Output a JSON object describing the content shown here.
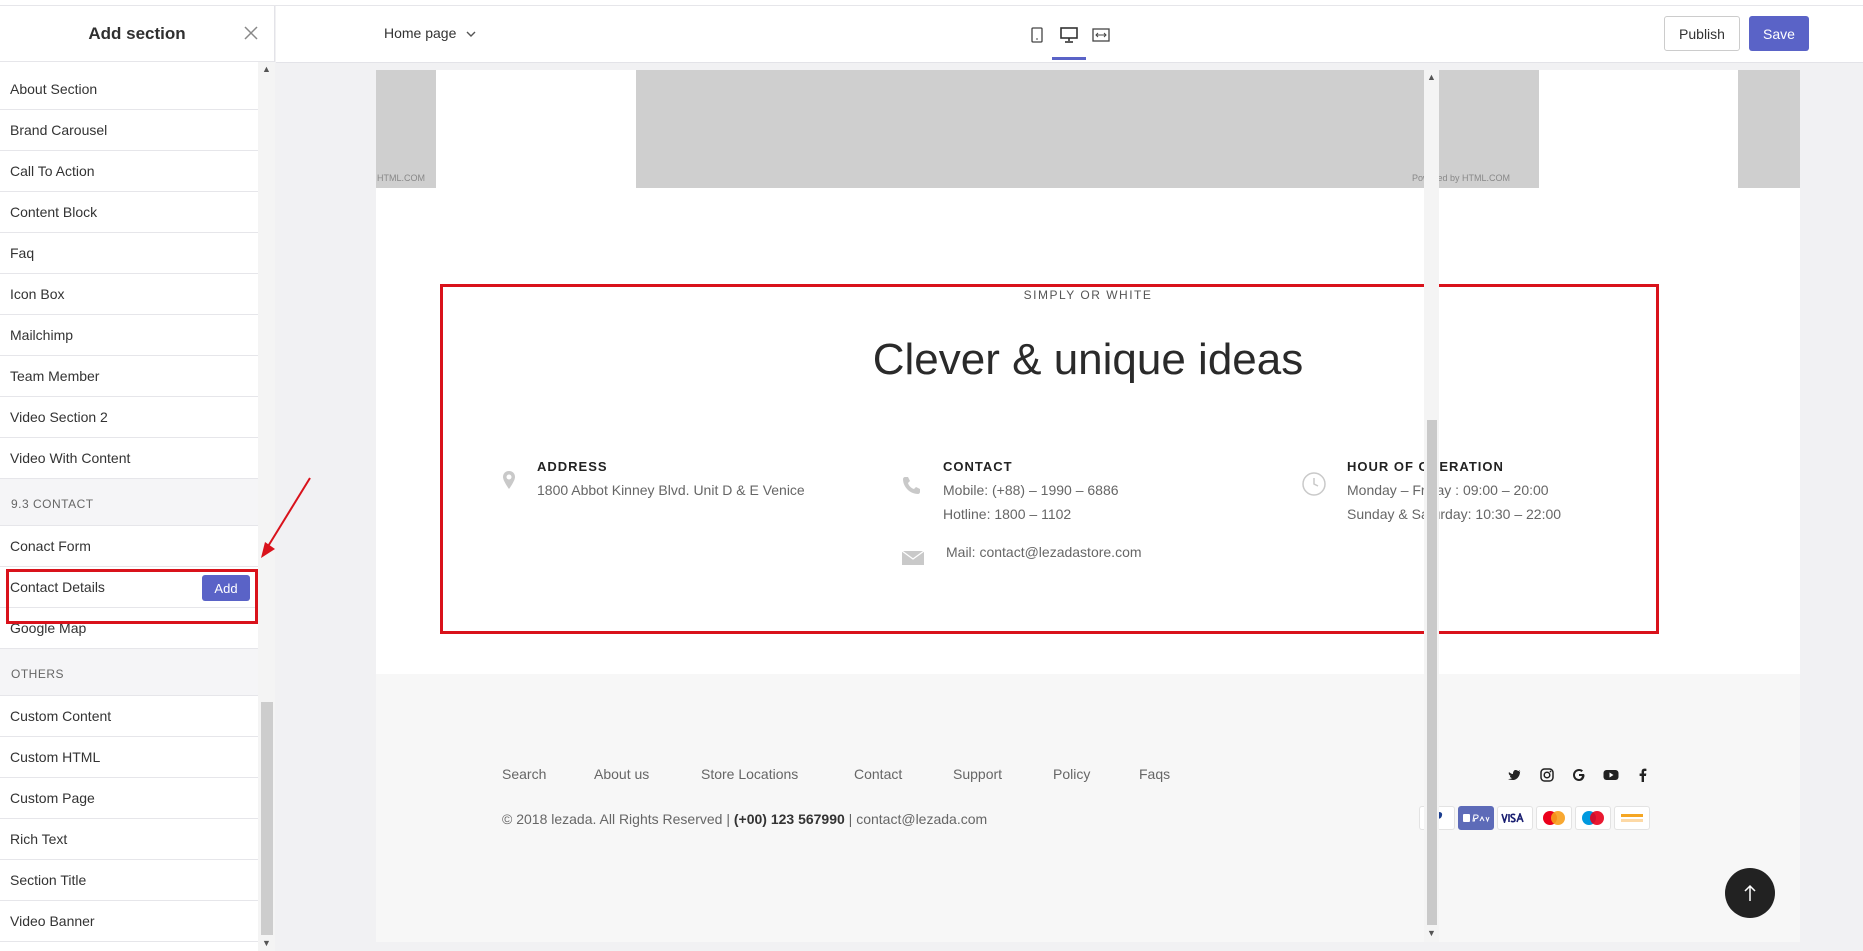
{
  "sidebar": {
    "title": "Add section",
    "items": [
      {
        "label": "About Section"
      },
      {
        "label": "Brand Carousel"
      },
      {
        "label": "Call To Action"
      },
      {
        "label": "Content Block"
      },
      {
        "label": "Faq"
      },
      {
        "label": "Icon Box"
      },
      {
        "label": "Mailchimp"
      },
      {
        "label": "Team Member"
      },
      {
        "label": "Video Section 2"
      },
      {
        "label": "Video With Content"
      }
    ],
    "group_contact": "9.3 CONTACT",
    "contact_items": [
      {
        "label": "Conact Form"
      },
      {
        "label": "Contact Details"
      },
      {
        "label": "Google Map"
      }
    ],
    "add_label": "Add",
    "group_others": "OTHERS",
    "others_items": [
      {
        "label": "Custom Content"
      },
      {
        "label": "Custom HTML"
      },
      {
        "label": "Custom Page"
      },
      {
        "label": "Rich Text"
      },
      {
        "label": "Section Title"
      },
      {
        "label": "Video Banner"
      }
    ]
  },
  "topbar": {
    "page": "Home page",
    "publish": "Publish",
    "save": "Save",
    "active_device": "desktop"
  },
  "preview": {
    "powered_left": "HTML.COM",
    "powered_right": "Powered by HTML.COM",
    "eyebrow": "SIMPLY OR WHITE",
    "headline": "Clever & unique ideas",
    "address": {
      "title": "ADDRESS",
      "line1": "1800 Abbot Kinney Blvd. Unit D & E Venice"
    },
    "contact": {
      "title": "CONTACT",
      "mobile": "Mobile: (+88) – 1990 – 6886",
      "hotline": "Hotline: 1800 – 1102",
      "mail": "Mail: contact@lezadastore.com"
    },
    "hours": {
      "title": "HOUR OF OPERATION",
      "line1": "Monday – Friday : 09:00 – 20:00",
      "line2": "Sunday & Saturday: 10:30 – 22:00"
    },
    "footer_links": [
      "Search",
      "About us",
      "Store Locations",
      "Contact",
      "Support",
      "Policy",
      "Faqs"
    ],
    "copyright_pre": "© 2018 lezada. All Rights Reserved | ",
    "copyright_phone": "(+00) 123 567990",
    "copyright_post": "  | contact@lezada.com",
    "payments": [
      "PayPal",
      "Apple Pay",
      "VISA",
      "Mastercard",
      "Maestro",
      "Discover"
    ]
  },
  "colors": {
    "accent": "#5a63c7",
    "highlight": "#d9121b"
  }
}
